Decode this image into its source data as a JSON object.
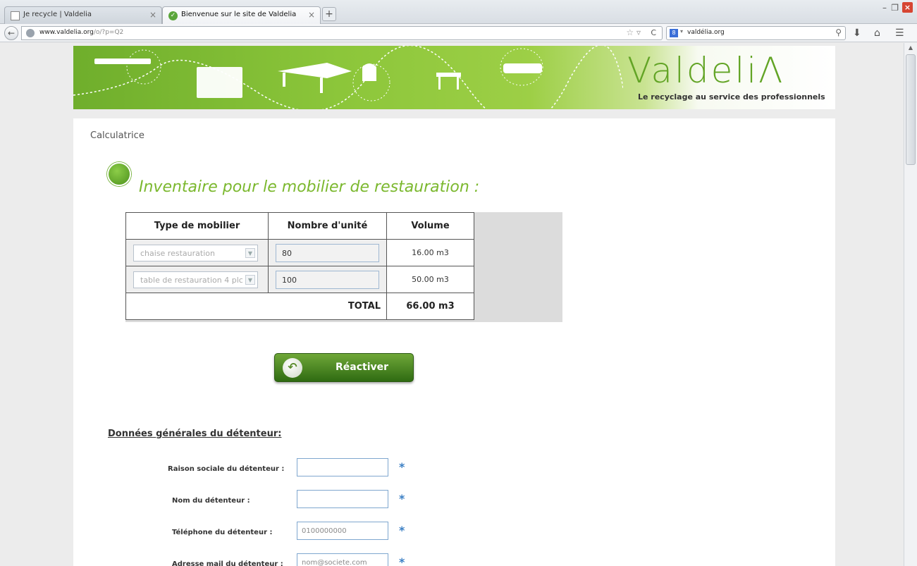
{
  "browser": {
    "tabs": [
      {
        "title": "Je recycle | Valdelia",
        "active": false
      },
      {
        "title": "Bienvenue sur le site de Valdelia",
        "active": true
      }
    ],
    "url_host": "www.valdelia.org",
    "url_path": "/o/?p=Q2",
    "search_text": "valdélia.org",
    "icons": {
      "back": "back-arrow-icon",
      "new_tab": "plus-icon",
      "bookmark": "star-icon",
      "reload": "reload-icon",
      "search": "magnifier-icon",
      "download": "download-icon",
      "home": "home-icon",
      "menu": "menu-icon"
    }
  },
  "banner": {
    "logo_text": "ValdeliΛ",
    "tagline": "Le recyclage au service des professionnels",
    "brand_color": "#62a425"
  },
  "page": {
    "breadcrumb": "Calculatrice",
    "section_title": "Inventaire pour le mobilier de restauration :",
    "table": {
      "headers": [
        "Type de mobilier",
        "Nombre d'unité",
        "Volume"
      ],
      "rows": [
        {
          "type": "chaise restauration",
          "count": "80",
          "volume": "16.00 m3"
        },
        {
          "type": "table de restauration 4 plc",
          "count": "100",
          "volume": "50.00 m3"
        }
      ],
      "total_label": "TOTAL",
      "total_value": "66.00 m3"
    },
    "reactivate_label": "Réactiver",
    "holder_section_title": "Données générales du détenteur:",
    "form": [
      {
        "label": "Raison sociale du détenteur :",
        "value": "",
        "placeholder": ""
      },
      {
        "label": "Nom du détenteur :",
        "value": "",
        "placeholder": ""
      },
      {
        "label": "Téléphone du détenteur :",
        "value": "",
        "placeholder": "0100000000"
      },
      {
        "label": "Adresse mail du détenteur :",
        "value": "",
        "placeholder": "nom@societe.com"
      }
    ],
    "required_marker": "*"
  }
}
